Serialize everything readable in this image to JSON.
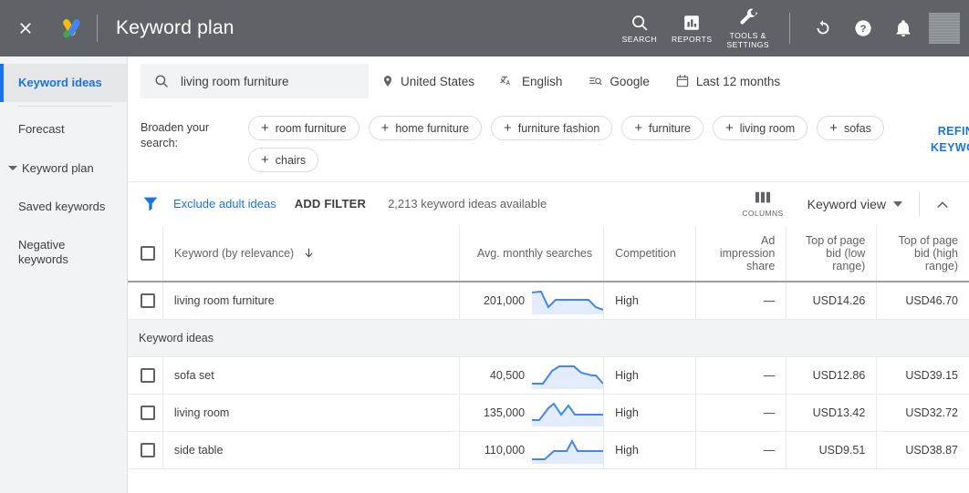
{
  "topbar": {
    "close_icon": "close-icon",
    "logo_icon": "google-ads-logo",
    "title": "Keyword plan",
    "items": [
      {
        "label": "SEARCH",
        "icon": "search-icon"
      },
      {
        "label": "REPORTS",
        "icon": "bar-chart-icon"
      },
      {
        "label": "TOOLS &\nSETTINGS",
        "label_line1": "TOOLS &",
        "label_line2": "SETTINGS",
        "icon": "wrench-icon"
      }
    ],
    "refresh_icon": "refresh-icon",
    "help_icon": "help-icon",
    "notifications_icon": "bell-icon",
    "avatar": "avatar"
  },
  "sidebar": {
    "items": [
      {
        "label": "Keyword ideas",
        "active": true
      },
      {
        "label": "Forecast",
        "active": false
      },
      {
        "label": "Keyword plan",
        "active": false,
        "caret": true
      },
      {
        "label": "Saved keywords",
        "active": false
      },
      {
        "label": "Negative keywords",
        "active": false
      }
    ]
  },
  "search": {
    "value": "living room furniture",
    "icon": "search-icon",
    "filters": [
      {
        "label": "United States",
        "icon": "location-pin-icon"
      },
      {
        "label": "English",
        "icon": "translate-icon"
      },
      {
        "label": "Google",
        "icon": "search-network-icon"
      },
      {
        "label": "Last 12 months",
        "icon": "calendar-icon"
      }
    ]
  },
  "broaden": {
    "label": "Broaden your search:",
    "chips": [
      "room furniture",
      "home furniture",
      "furniture fashion",
      "furniture",
      "living room",
      "sofas",
      "chairs"
    ],
    "refine_link_line1": "REFINE",
    "refine_link_line2": "KEYWORDS"
  },
  "toolbar": {
    "filter_icon": "filter-funnel-icon",
    "exclude_adult": "Exclude adult ideas",
    "add_filter": "ADD FILTER",
    "count_text": "2,213 keyword ideas available",
    "columns_label": "COLUMNS",
    "columns_icon": "columns-icon",
    "view_label": "Keyword view",
    "collapse_icon": "chevron-up-icon"
  },
  "table": {
    "headers": {
      "keyword": "Keyword (by relevance)",
      "sort_icon": "arrow-down-icon",
      "avg_searches": "Avg. monthly searches",
      "competition": "Competition",
      "ad_impression_share": "Ad impression share",
      "bid_low": "Top of page bid (low range)",
      "bid_high": "Top of page bid (high range)"
    },
    "group_label": "Keyword ideas",
    "rows": [
      {
        "keyword": "living room furniture",
        "avg_searches": "201,000",
        "competition": "High",
        "ad_impression_share": "—",
        "bid_low": "USD14.26",
        "bid_high": "USD46.70",
        "spark": "0,6 10,5 18,22 26,14 30,14 62,14 70,22 78,25"
      },
      {
        "keyword": "sofa set",
        "avg_searches": "40,500",
        "competition": "High",
        "ad_impression_share": "—",
        "bid_low": "USD12.86",
        "bid_high": "USD39.15",
        "spark": "0,24 12,24 22,10 30,5 46,5 54,12 66,15 70,15 78,24"
      },
      {
        "keyword": "living room",
        "avg_searches": "135,000",
        "competition": "High",
        "ad_impression_share": "—",
        "bid_low": "USD13.42",
        "bid_high": "USD32.72",
        "spark": "0,23 8,23 18,10 24,5 32,17 40,7 47,17 56,17 78,17"
      },
      {
        "keyword": "side table",
        "avg_searches": "110,000",
        "competition": "High",
        "ad_impression_share": "—",
        "bid_low": "USD9.51",
        "bid_high": "USD38.87",
        "spark": "0,25 14,25 24,16 38,16 44,5 50,16 60,16 78,16"
      }
    ]
  },
  "colors": {
    "accent_blue": "#1a73e8",
    "topbar_gray": "#5f6368",
    "spark_line": "#4285f4",
    "spark_fill": "#e3ecfd"
  }
}
